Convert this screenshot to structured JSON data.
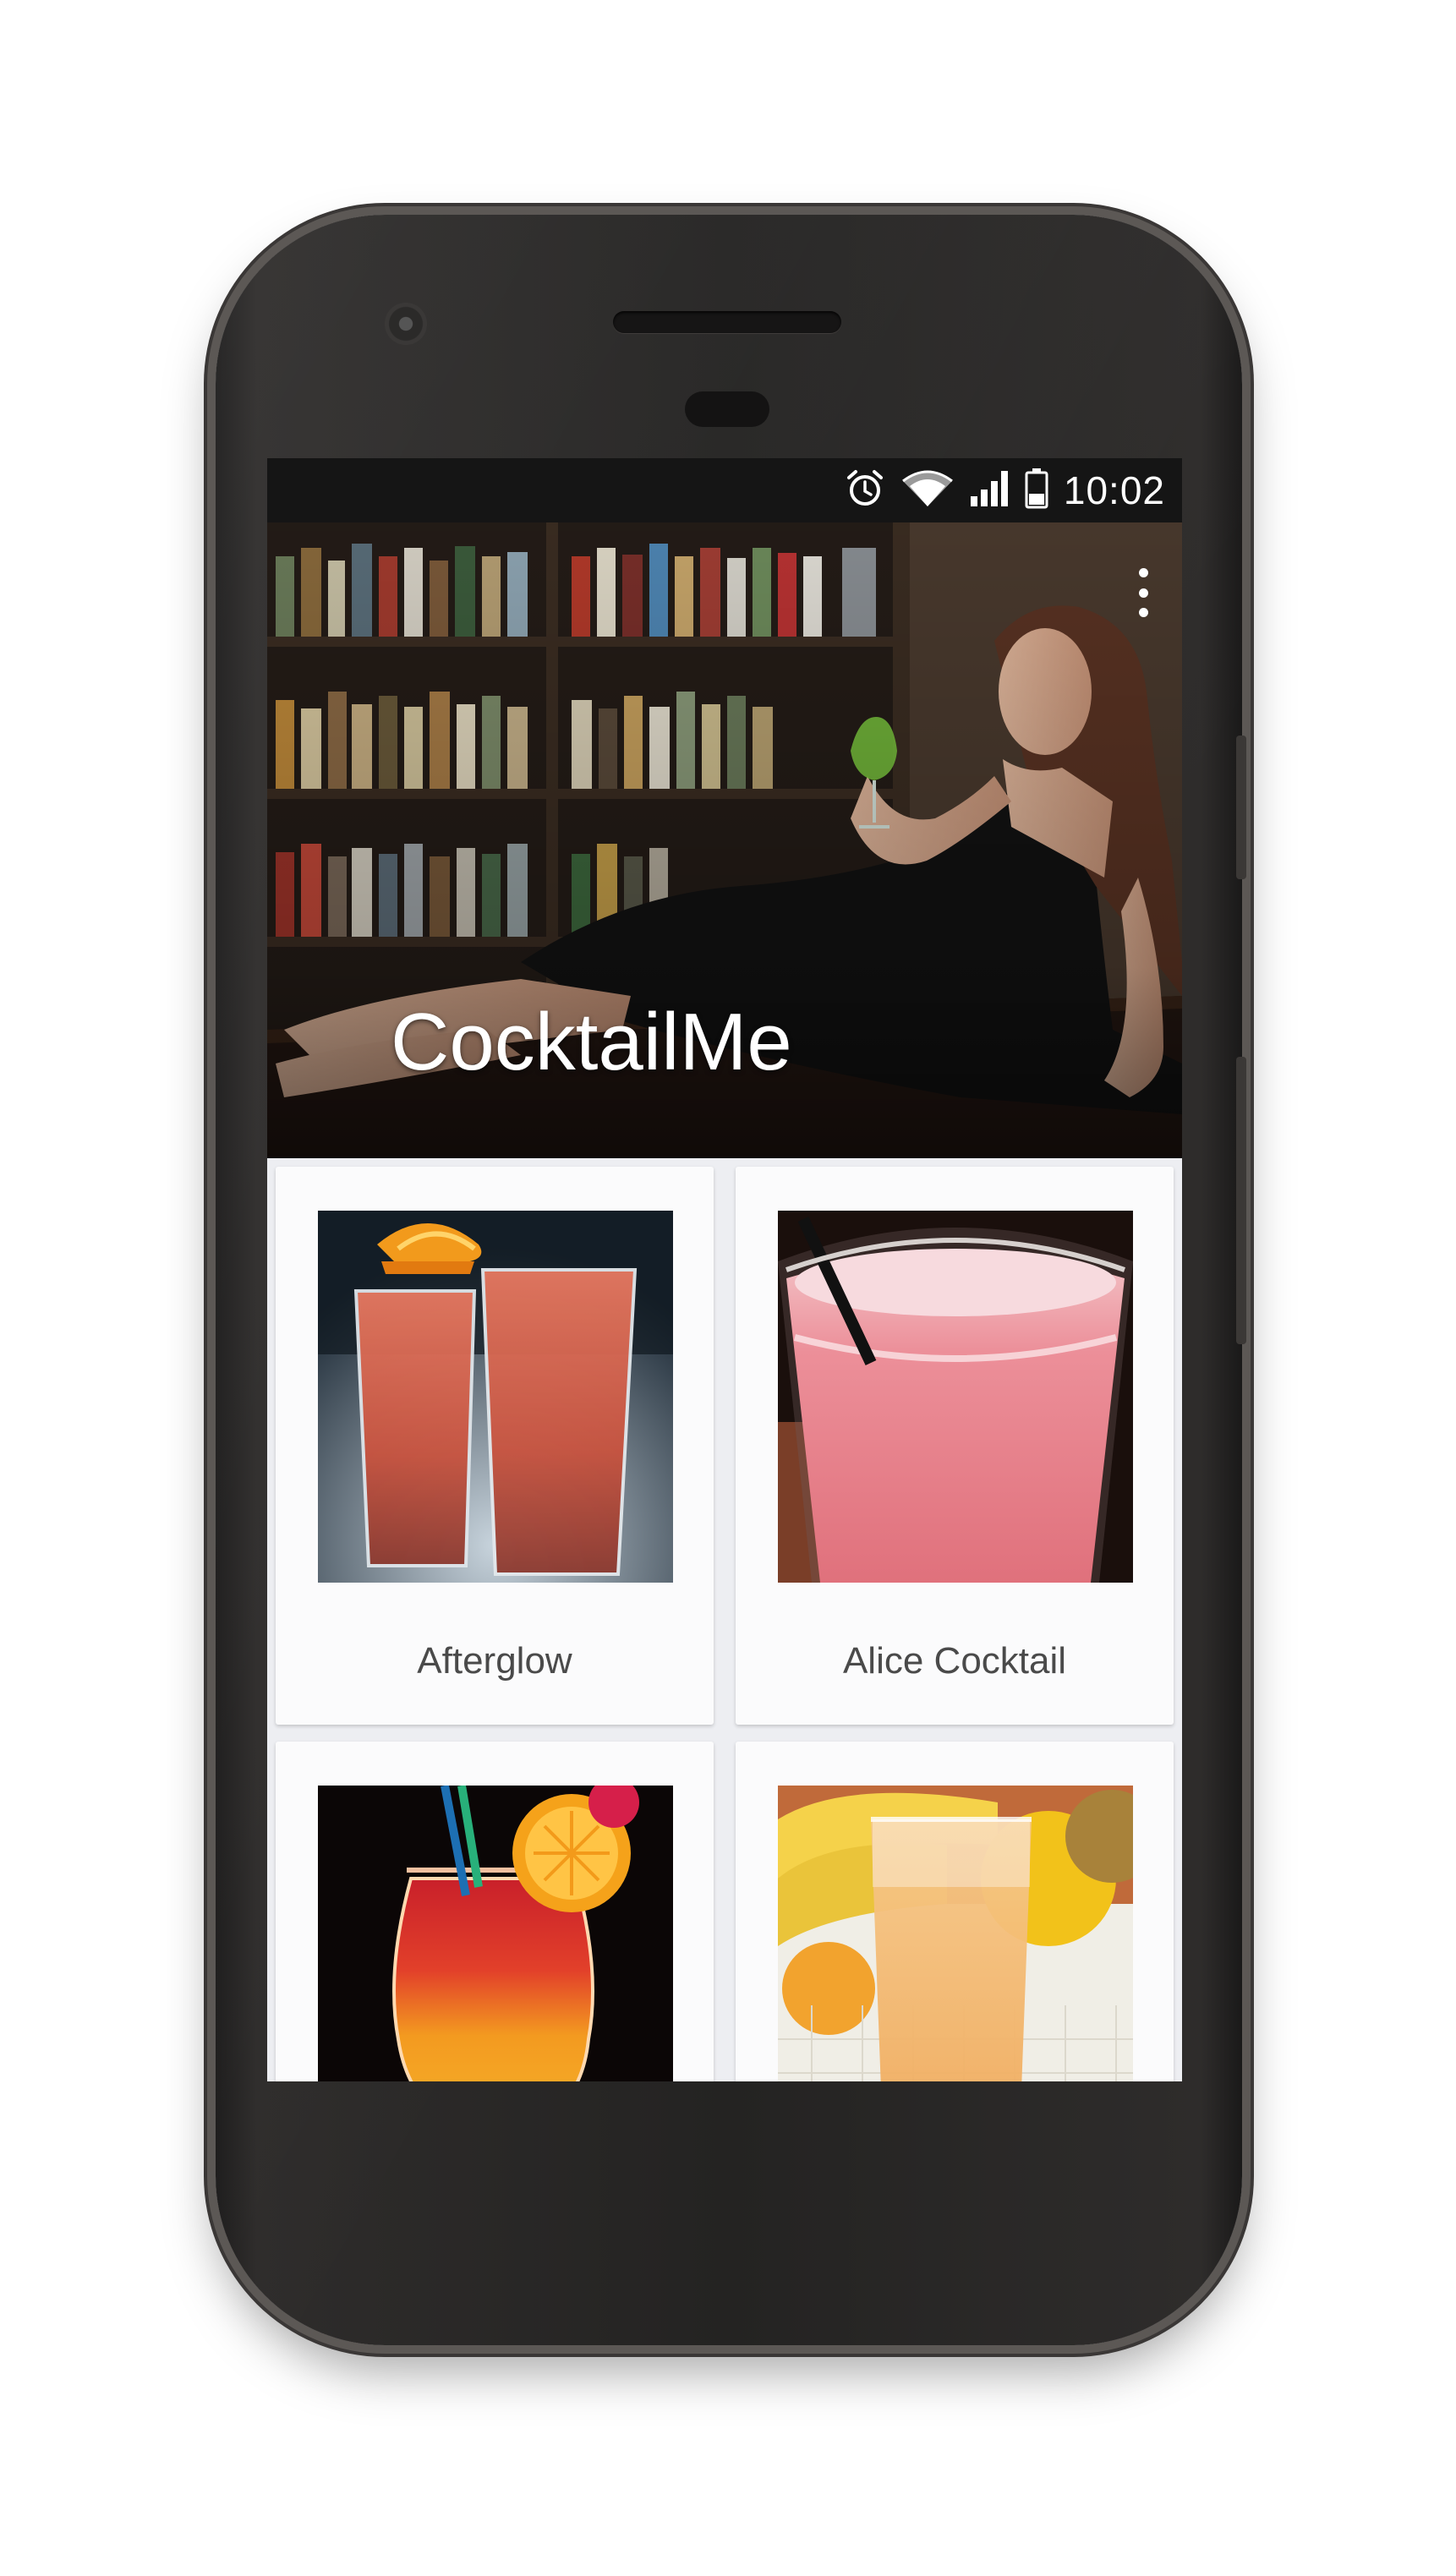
{
  "status_bar": {
    "time": "10:02",
    "icons": [
      "alarm-icon",
      "wifi-icon",
      "signal-icon",
      "battery-icon"
    ]
  },
  "app": {
    "title": "CocktailMe",
    "menu_icon": "overflow-menu-icon"
  },
  "cocktails": [
    {
      "name": "Afterglow",
      "image": "afterglow-photo"
    },
    {
      "name": "Alice Cocktail",
      "image": "alice-cocktail-photo"
    },
    {
      "name": "",
      "image": "layered-cocktail-photo"
    },
    {
      "name": "",
      "image": "orange-juice-cocktail-photo"
    }
  ],
  "colors": {
    "card_background": "#fbfbfc",
    "grid_background": "#edeef2",
    "status_bar": "#151515"
  }
}
